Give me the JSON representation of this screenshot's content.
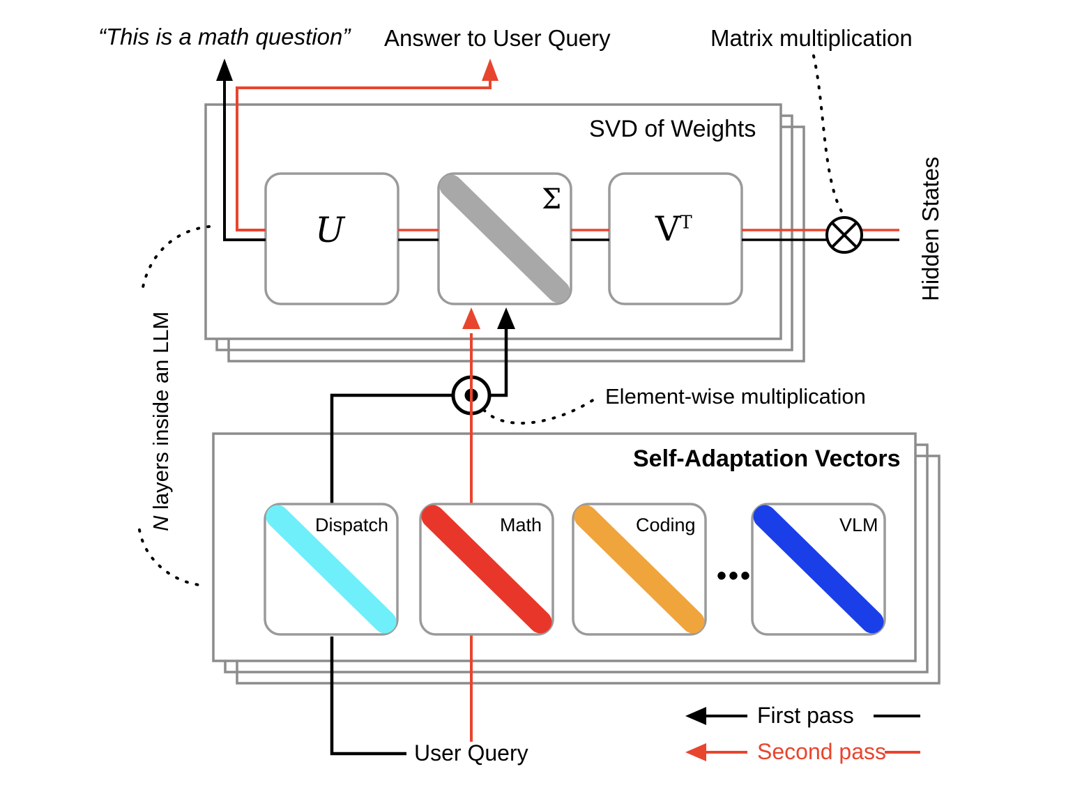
{
  "diagram": {
    "title_svd_panel": "SVD of Weights",
    "title_sav_panel": "Self-Adaptation Vectors",
    "captions": {
      "quote": "“This is a math question”",
      "answer": "Answer to User Query",
      "matrix_mult": "Matrix multiplication",
      "elementwise_mult": "Element-wise multiplication",
      "hidden_states": "Hidden States",
      "n_layers_italic": "N",
      "n_layers_rest": " layers inside an LLM",
      "user_query": "User Query"
    },
    "svd_blocks": [
      {
        "name": "U",
        "label": "U",
        "style": "serif-italic"
      },
      {
        "name": "Sigma",
        "label": "Σ",
        "style": "serif",
        "diagonal_color": "#a8a8a8"
      },
      {
        "name": "VT",
        "label": "V",
        "superscript": "T",
        "style": "serif"
      }
    ],
    "adaptation_vectors": [
      {
        "label": "Dispatch",
        "color": "#6eeffa"
      },
      {
        "label": "Math",
        "color": "#e8372a"
      },
      {
        "label": "Coding",
        "color": "#f0a43c"
      },
      {
        "label": "VLM",
        "color": "#1a3fe8"
      }
    ],
    "ellipsis": "•••",
    "legend": [
      {
        "label": "First pass",
        "color": "#000000"
      },
      {
        "label": "Second pass",
        "color": "#e8452e"
      }
    ],
    "operators": {
      "matrix_mult_symbol": "⊗",
      "elementwise_mult_symbol": "⊙"
    },
    "colors": {
      "first_pass": "#000000",
      "second_pass": "#e8452e",
      "panel_border": "#8c8c8c",
      "block_border": "#9a9a9a",
      "sigma_gray": "#a8a8a8",
      "background": "#ffffff"
    },
    "layer_stack_count": 3
  }
}
